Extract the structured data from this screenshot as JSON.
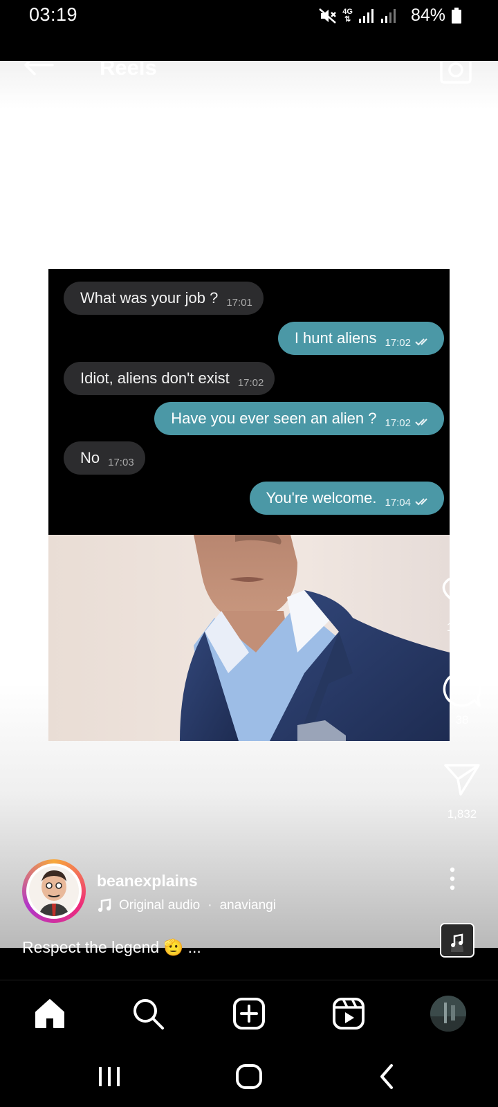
{
  "status": {
    "time": "03:19",
    "network": "4G",
    "battery": "84%"
  },
  "header": {
    "title": "Reels"
  },
  "chat": {
    "messages": [
      {
        "dir": "in",
        "text": "What was your job ?",
        "time": "17:01"
      },
      {
        "dir": "out",
        "text": "I hunt aliens",
        "time": "17:02"
      },
      {
        "dir": "in",
        "text": "Idiot, aliens don't exist",
        "time": "17:02"
      },
      {
        "dir": "out",
        "text": "Have you ever seen an alien ?",
        "time": "17:02"
      },
      {
        "dir": "in",
        "text": "No",
        "time": "17:03"
      },
      {
        "dir": "out",
        "text": "You're welcome.",
        "time": "17:04"
      }
    ]
  },
  "actions": {
    "likes": "10.9K",
    "comments": "38",
    "shares": "1,832"
  },
  "post": {
    "username": "beanexplains",
    "audio": "Original audio",
    "audio_user": "anaviangi",
    "caption": "Respect the legend 🫡 ..."
  },
  "nav": {
    "items": [
      "home-icon",
      "search-icon",
      "create-icon",
      "reels-icon",
      "profile-avatar"
    ]
  },
  "colors": {
    "incoming_bubble": "#2c2c2e",
    "outgoing_bubble": "#4b98a6"
  }
}
